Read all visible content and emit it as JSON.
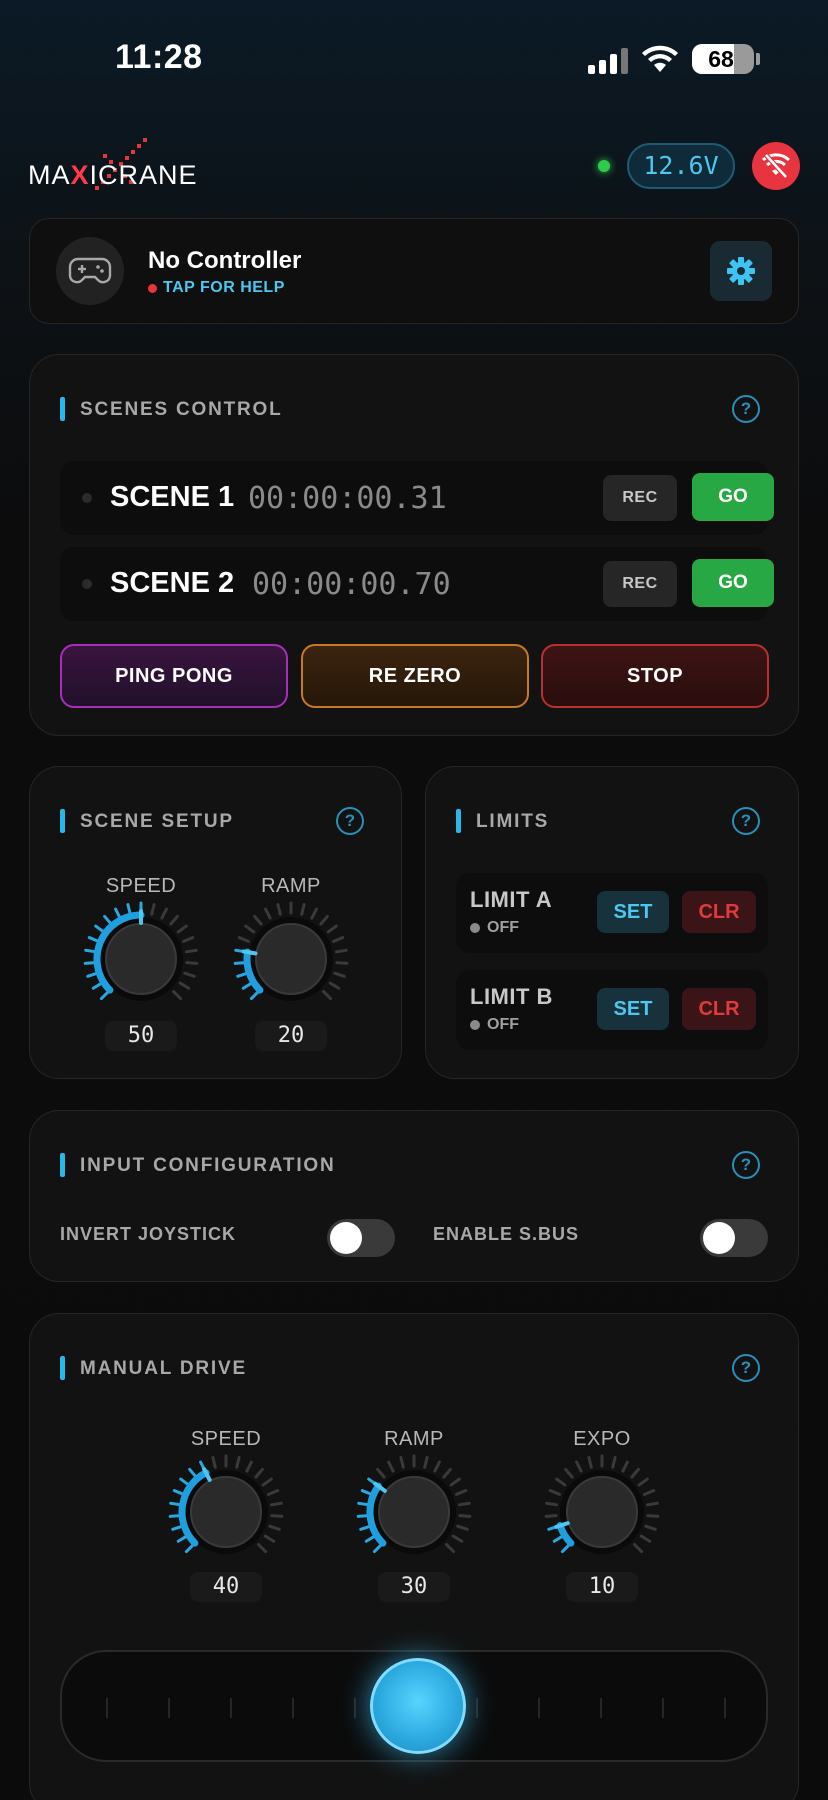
{
  "status_bar": {
    "time": "11:28",
    "battery": "68"
  },
  "header": {
    "logo_parts": [
      "MA",
      "X",
      "ICRANE"
    ],
    "voltage": "12.6V",
    "colors": {
      "accent": "#29b6e8",
      "connected": "#2ecc4a",
      "alert": "#e8343f"
    }
  },
  "controller": {
    "title": "No Controller",
    "help": "TAP FOR HELP",
    "icon": "gamepad-icon",
    "settings_icon": "gear-icon"
  },
  "scenes": {
    "title": "SCENES CONTROL",
    "help": "?",
    "rows": [
      {
        "name": "SCENE 1",
        "time": "00:00:00.31",
        "rec": "REC",
        "go": "GO"
      },
      {
        "name": "SCENE 2",
        "time": "00:00:00.70",
        "rec": "REC",
        "go": "GO"
      }
    ],
    "buttons": {
      "ping_pong": "PING PONG",
      "re_zero": "RE ZERO",
      "stop": "STOP"
    }
  },
  "scene_setup": {
    "title": "SCENE SETUP",
    "help": "?",
    "knobs": [
      {
        "label": "SPEED",
        "value": "50",
        "level": 0.5
      },
      {
        "label": "RAMP",
        "value": "20",
        "level": 0.2
      }
    ]
  },
  "limits": {
    "title": "LIMITS",
    "help": "?",
    "rows": [
      {
        "name": "LIMIT A",
        "state": "OFF",
        "set": "SET",
        "clr": "CLR"
      },
      {
        "name": "LIMIT B",
        "state": "OFF",
        "set": "SET",
        "clr": "CLR"
      }
    ]
  },
  "input_config": {
    "title": "INPUT CONFIGURATION",
    "help": "?",
    "invert_joystick": "INVERT JOYSTICK",
    "enable_sbus": "ENABLE S.BUS"
  },
  "manual_drive": {
    "title": "MANUAL DRIVE",
    "help": "?",
    "knobs": [
      {
        "label": "SPEED",
        "value": "40",
        "level": 0.4
      },
      {
        "label": "RAMP",
        "value": "30",
        "level": 0.3
      },
      {
        "label": "EXPO",
        "value": "10",
        "level": 0.1
      }
    ],
    "slider_level": 0.5
  }
}
